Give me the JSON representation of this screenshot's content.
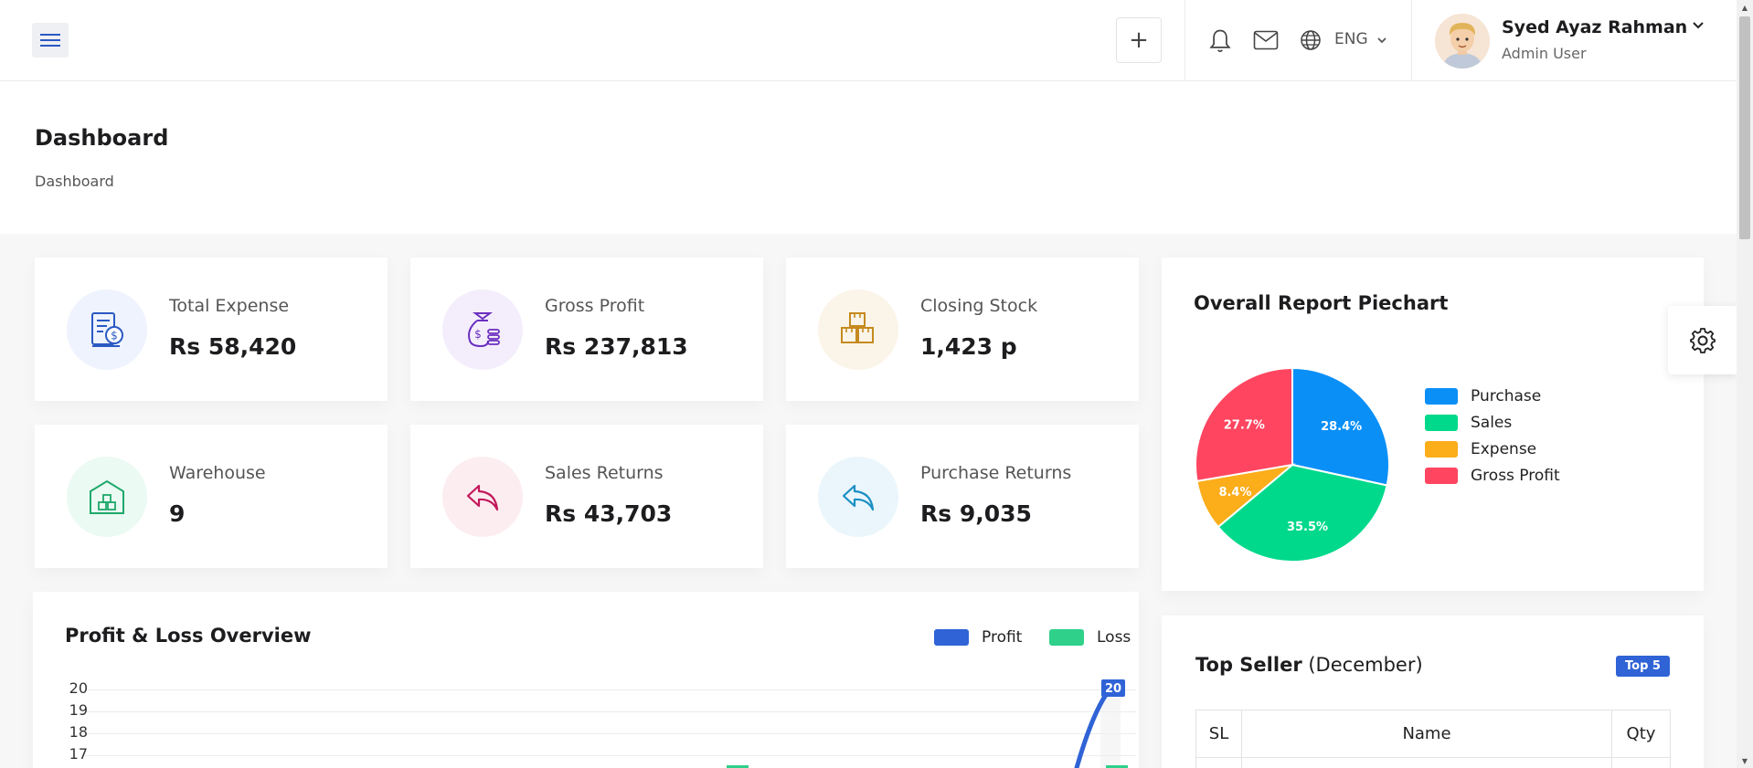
{
  "header": {
    "language": "ENG",
    "user": {
      "name": "Syed Ayaz Rahman",
      "role": "Admin User"
    }
  },
  "page": {
    "title": "Dashboard",
    "breadcrumb": "Dashboard"
  },
  "stats": [
    {
      "label": "Total Expense",
      "value": "Rs 58,420",
      "icon": "invoice-dollar-icon",
      "color": "#2b59c3"
    },
    {
      "label": "Gross Profit",
      "value": "Rs 237,813",
      "icon": "money-bag-icon",
      "color": "#6b2fbf"
    },
    {
      "label": "Closing Stock",
      "value": "1,423 p",
      "icon": "boxes-icon",
      "color": "#c58a1f"
    },
    {
      "label": "Warehouse",
      "value": "9",
      "icon": "warehouse-icon",
      "color": "#1fa86b"
    },
    {
      "label": "Sales Returns",
      "value": "Rs 43,703",
      "icon": "reply-arrow-icon",
      "color": "#c2185b"
    },
    {
      "label": "Purchase Returns",
      "value": "Rs 9,035",
      "icon": "reply-arrow-icon",
      "color": "#1a8fc4"
    }
  ],
  "pie": {
    "title": "Overall Report Piechart",
    "chart_data": {
      "type": "pie",
      "labels": [
        "Purchase",
        "Sales",
        "Expense",
        "Gross Profit"
      ],
      "values": [
        28.4,
        35.5,
        8.4,
        27.7
      ],
      "value_labels": [
        "28.4%",
        "35.5%",
        "8.4%",
        "27.7%"
      ],
      "colors": [
        "#0a8ff7",
        "#00d98b",
        "#fbad1a",
        "#ff4560"
      ],
      "legend_position": "right"
    }
  },
  "profit_loss": {
    "title": "Profit & Loss Overview",
    "legend": [
      {
        "name": "Profit",
        "color": "#2f63d6"
      },
      {
        "name": "Loss",
        "color": "#2fd08a"
      }
    ],
    "chart_data": {
      "type": "line",
      "series": [
        {
          "name": "Profit",
          "last_value_label": "20"
        },
        {
          "name": "Loss"
        }
      ],
      "y_ticks": [
        "20",
        "19",
        "18",
        "17"
      ],
      "ylim": [
        17,
        20
      ],
      "grid": true
    }
  },
  "top_seller": {
    "title": "Top Seller",
    "period": "(December)",
    "badge": "Top 5",
    "columns": [
      "SL",
      "Name",
      "Qty"
    ]
  }
}
